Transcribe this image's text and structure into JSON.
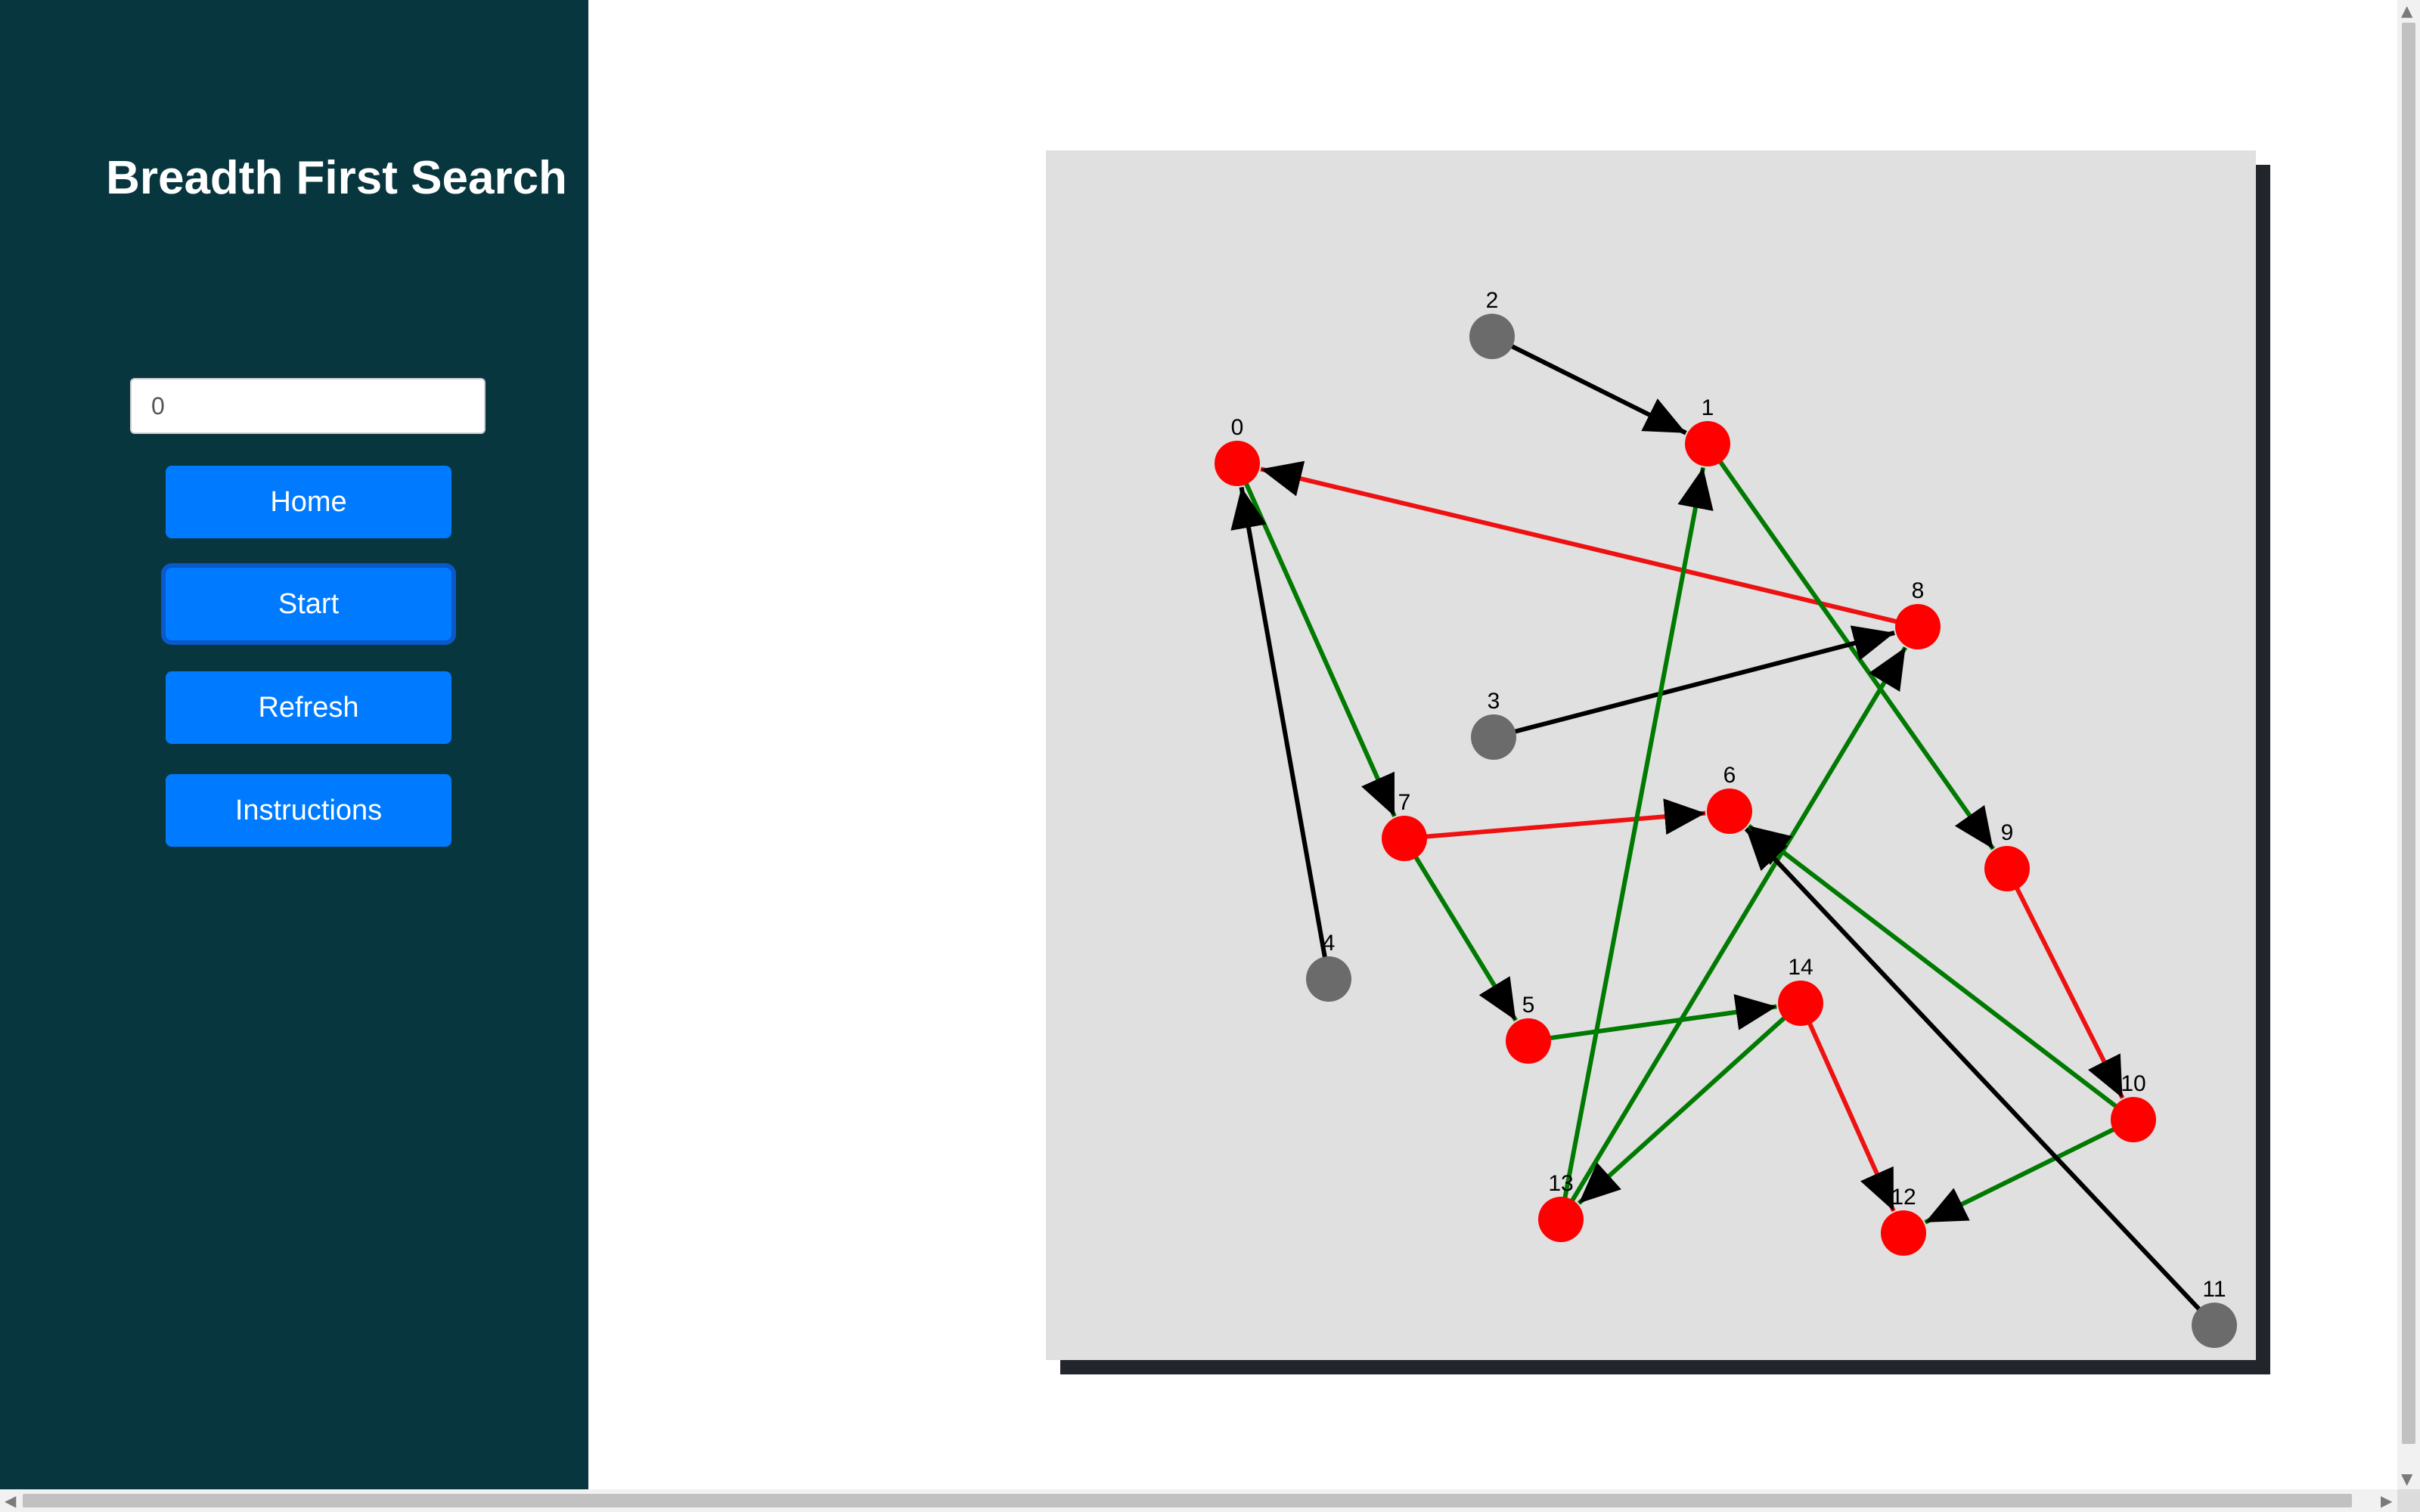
{
  "app": {
    "title": "Breadth First Search"
  },
  "sidebar": {
    "start_node_input": {
      "value": "0"
    },
    "buttons": {
      "home": "Home",
      "start": "Start",
      "refresh": "Refresh",
      "instructions": "Instructions"
    }
  },
  "colors": {
    "sidebar_bg": "#07363e",
    "button_bg": "#007bff",
    "visited_node": "#ff0000",
    "unvisited_node": "#6b6b6b",
    "tree_edge": "#007a00",
    "back_edge": "#ee1111",
    "unvisited_edge": "#000000",
    "canvas_bg": "#e0e0e0"
  },
  "graph": {
    "nodes": [
      {
        "id": "0",
        "state": "visited"
      },
      {
        "id": "1",
        "state": "visited"
      },
      {
        "id": "2",
        "state": "unvisited"
      },
      {
        "id": "3",
        "state": "unvisited"
      },
      {
        "id": "4",
        "state": "unvisited"
      },
      {
        "id": "5",
        "state": "visited"
      },
      {
        "id": "6",
        "state": "visited"
      },
      {
        "id": "7",
        "state": "visited"
      },
      {
        "id": "8",
        "state": "visited"
      },
      {
        "id": "9",
        "state": "visited"
      },
      {
        "id": "10",
        "state": "visited"
      },
      {
        "id": "11",
        "state": "unvisited"
      },
      {
        "id": "12",
        "state": "visited"
      },
      {
        "id": "13",
        "state": "visited"
      },
      {
        "id": "14",
        "state": "visited"
      }
    ],
    "edges": [
      {
        "from": "2",
        "to": "1",
        "kind": "unvisited"
      },
      {
        "from": "8",
        "to": "0",
        "kind": "back"
      },
      {
        "from": "0",
        "to": "7",
        "kind": "tree"
      },
      {
        "from": "4",
        "to": "0",
        "kind": "unvisited"
      },
      {
        "from": "1",
        "to": "9",
        "kind": "tree"
      },
      {
        "from": "3",
        "to": "8",
        "kind": "unvisited"
      },
      {
        "from": "7",
        "to": "6",
        "kind": "back"
      },
      {
        "from": "7",
        "to": "5",
        "kind": "tree"
      },
      {
        "from": "5",
        "to": "14",
        "kind": "tree"
      },
      {
        "from": "13",
        "to": "1",
        "kind": "tree"
      },
      {
        "from": "13",
        "to": "8",
        "kind": "tree"
      },
      {
        "from": "14",
        "to": "13",
        "kind": "tree"
      },
      {
        "from": "14",
        "to": "12",
        "kind": "back"
      },
      {
        "from": "9",
        "to": "10",
        "kind": "back"
      },
      {
        "from": "10",
        "to": "6",
        "kind": "tree"
      },
      {
        "from": "10",
        "to": "12",
        "kind": "tree"
      },
      {
        "from": "11",
        "to": "6",
        "kind": "unvisited"
      }
    ]
  }
}
